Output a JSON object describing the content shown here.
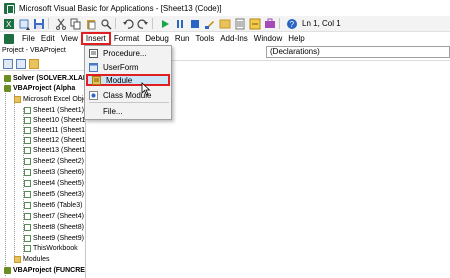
{
  "window": {
    "title": "Microsoft Visual Basic for Applications - [Sheet13 (Code)]"
  },
  "toolbar": {
    "position": "Ln 1, Col 1"
  },
  "menu": [
    "File",
    "Edit",
    "View",
    "Insert",
    "Format",
    "Debug",
    "Run",
    "Tools",
    "Add-Ins",
    "Window",
    "Help"
  ],
  "insert_menu": {
    "items": [
      "Procedure...",
      "UserForm",
      "Module",
      "Class Module",
      "File..."
    ]
  },
  "project": {
    "header": "Project - VBAProject",
    "tree": [
      "Solver (SOLVER.XLAM)",
      "VBAProject (Alpha",
      "Microsoft Excel Objects",
      "Sheet1 (Sheet1)",
      "Sheet10 (Sheet10)",
      "Sheet11 (Sheet14)",
      "Sheet12 (Sheet11)",
      "Sheet13 (Sheet12)",
      "Sheet2 (Sheet2)",
      "Sheet3 (Sheet6)",
      "Sheet4 (Sheet5)",
      "Sheet5 (Sheet3)",
      "Sheet6 (Table3)",
      "Sheet7 (Sheet4)",
      "Sheet8 (Sheet8)",
      "Sheet9 (Sheet9)",
      "ThisWorkbook",
      "Modules",
      "VBAProject (FUNCRES.XL"
    ]
  },
  "code": {
    "declarations": "(Declarations)"
  },
  "colors": {
    "highlight_border": "#e02020",
    "highlight_fill": "#cce4f7",
    "excel_green": "#1d6f42"
  }
}
